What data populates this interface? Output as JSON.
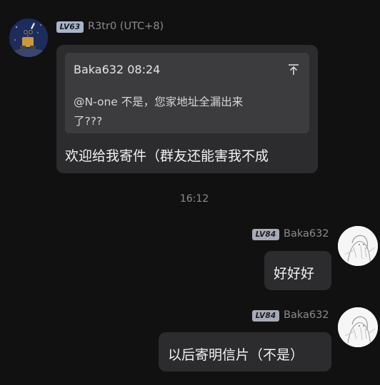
{
  "messages": [
    {
      "sender": "R3tr0 (UTC+8)",
      "level": "LV63",
      "avatar": "walle-avatar",
      "quote": {
        "author": "Baka632",
        "time": "08:24",
        "text_line1": "@N-one 不是，您家地址全漏出来",
        "text_line2": "了???"
      },
      "text": "欢迎给我寄件（群友还能害我不成"
    },
    {
      "sender": "Baka632",
      "level": "LV84",
      "avatar": "anime-sketch-avatar",
      "text": "好好好"
    },
    {
      "sender": "Baka632",
      "level": "LV84",
      "avatar": "anime-sketch-avatar",
      "text": "以后寄明信片（不是）"
    }
  ],
  "time_separator": "16:12",
  "icons": {
    "jump_to_quote": "jump-to-original-icon"
  },
  "colors": {
    "background": "#111112",
    "bubble": "#2c2c2e",
    "quote_box": "#3c3c3f",
    "badge_lv63": "#a8b4cc",
    "badge_lv84": "#a6aab4"
  }
}
